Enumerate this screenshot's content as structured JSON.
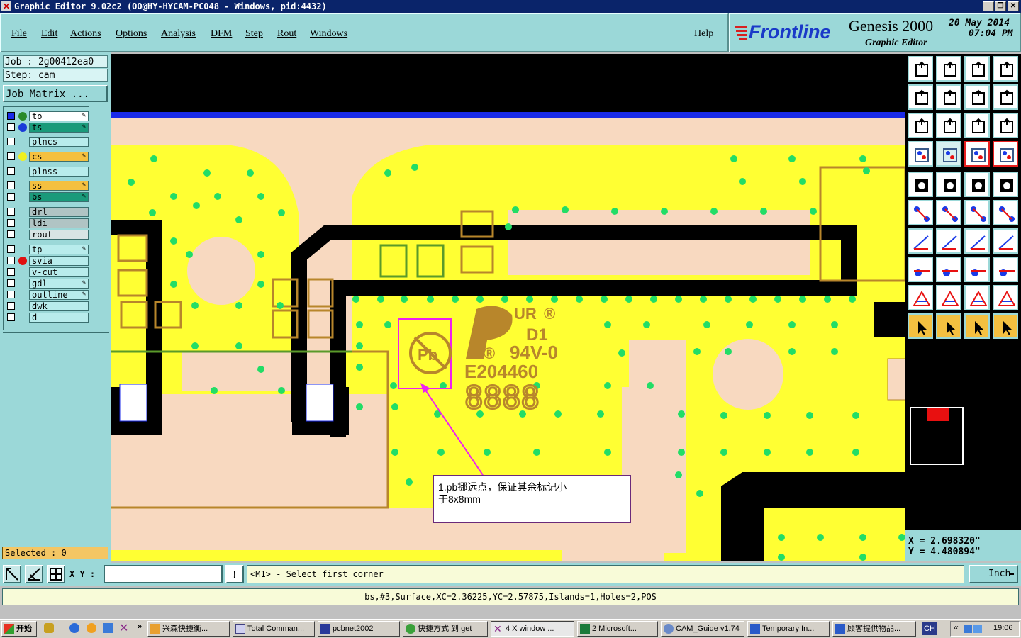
{
  "window": {
    "title": "Graphic Editor 9.02c2 (OO@HY-HYCAM-PC048 - Windows, pid:4432)"
  },
  "menu": [
    "File",
    "Edit",
    "Actions",
    "Options",
    "Analysis",
    "DFM",
    "Step",
    "Rout",
    "Windows"
  ],
  "help_label": "Help",
  "brand": {
    "logo": "Frontline",
    "product": "Genesis 2000",
    "subtitle": "Graphic Editor",
    "date": "20 May 2014",
    "time": "07:04 PM"
  },
  "job": {
    "job_line": "Job : 2g00412ea0",
    "step_line": "Step: cam",
    "matrix_label": "Job Matrix ..."
  },
  "layers": [
    {
      "name": "to",
      "color": "#ffffff",
      "dot": "#2a8a2a",
      "pen": true
    },
    {
      "name": "ts",
      "color": "#1a9a7a",
      "dot": "#1a3ad8",
      "pen": true
    },
    {
      "name": "plncs",
      "color": "#b8ecec",
      "dot": "",
      "pen": false
    },
    {
      "name": "cs",
      "color": "#f4c040",
      "dot": "#f0f020",
      "pen": true
    },
    {
      "name": "plnss",
      "color": "#b8ecec",
      "dot": "",
      "pen": false
    },
    {
      "name": "ss",
      "color": "#f4c040",
      "dot": "",
      "pen": true
    },
    {
      "name": "bs",
      "color": "#1a9a7a",
      "dot": "",
      "pen": true
    },
    {
      "name": "drl",
      "color": "#b0c4c4",
      "dot": "",
      "pen": false
    },
    {
      "name": "ldi",
      "color": "#b0c4c4",
      "dot": "",
      "pen": false
    },
    {
      "name": "rout",
      "color": "#d8e4e4",
      "dot": "",
      "pen": false
    },
    {
      "name": "tp",
      "color": "#b8ecec",
      "dot": "",
      "pen": true
    },
    {
      "name": "svia",
      "color": "#b8ecec",
      "dot": "#e01010",
      "pen": false
    },
    {
      "name": "v-cut",
      "color": "#b8ecec",
      "dot": "",
      "pen": false
    },
    {
      "name": "gdl",
      "color": "#b8ecec",
      "dot": "",
      "pen": true
    },
    {
      "name": "outline",
      "color": "#b8ecec",
      "dot": "",
      "pen": true
    },
    {
      "name": "dwk",
      "color": "#b8ecec",
      "dot": "",
      "pen": false
    },
    {
      "name": "d",
      "color": "#b8ecec",
      "dot": "",
      "pen": false
    }
  ],
  "selected_label": "Selected : 0",
  "board": {
    "ul_mark": "UR",
    "d1": "D1",
    "rating": "94V-0",
    "ul_file": "E204460",
    "date_code": "8888",
    "pb": "Pb"
  },
  "callout": {
    "line1": "1.pb挪远点，保证其余标记小",
    "line2": "于8x8mm"
  },
  "coords": {
    "x": "X = 2.698320\"",
    "y": "Y = 4.480894\""
  },
  "cmd": {
    "xy_label": "X Y :",
    "prompt": "<M1> - Select first corner",
    "unit": "Inch"
  },
  "status": "bs,#3,Surface,XC=2.36225,YC=2.57875,Islands=1,Holes=2,POS",
  "taskbar": {
    "start": "开始",
    "items": [
      "兴森快捷衡...",
      "Total Comman...",
      "pcbnet2002",
      "快捷方式 到 get",
      "4 X window ...",
      "2 Microsoft...",
      "CAM_Guide v1.74",
      "Temporary In...",
      "顾客提供物品..."
    ],
    "lang": "CH",
    "clock": "19:06"
  }
}
